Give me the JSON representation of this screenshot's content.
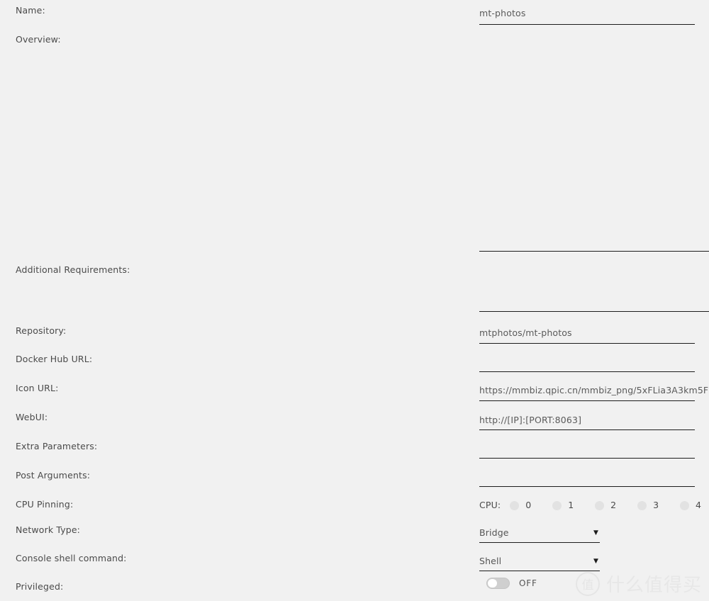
{
  "form": {
    "fields": [
      {
        "label": "Name:",
        "value": "mt-photos",
        "type": "text"
      },
      {
        "label": "Overview:",
        "value": "",
        "type": "textarea"
      },
      {
        "label": "Additional Requirements:",
        "value": "",
        "type": "textarea"
      },
      {
        "label": "Repository:",
        "value": "mtphotos/mt-photos",
        "type": "text"
      },
      {
        "label": "Docker Hub URL:",
        "value": "",
        "type": "text"
      },
      {
        "label": "Icon URL:",
        "value": "https://mmbiz.qpic.cn/mmbiz_png/5xFLia3A3km5F",
        "type": "text"
      },
      {
        "label": "WebUI:",
        "value": "http://[IP]:[PORT:8063]",
        "type": "text"
      },
      {
        "label": "Extra Parameters:",
        "value": "",
        "type": "text"
      },
      {
        "label": "Post Arguments:",
        "value": "",
        "type": "text"
      },
      {
        "label": "CPU Pinning:",
        "value": "",
        "type": "radio-group"
      },
      {
        "label": "Network Type:",
        "value": "Bridge",
        "type": "select"
      },
      {
        "label": "Console shell command:",
        "value": "Shell",
        "type": "select"
      },
      {
        "label": "Privileged:",
        "value": "OFF",
        "type": "toggle"
      }
    ],
    "cpu_pinning": {
      "caption": "CPU:",
      "options": [
        "0",
        "1",
        "2",
        "3",
        "4"
      ],
      "selected": null
    },
    "network_type": {
      "selected": "Bridge",
      "arrow": "▼"
    },
    "console_shell": {
      "selected": "Shell",
      "arrow": "▼"
    },
    "privileged": {
      "state_label": "OFF",
      "on": false
    }
  },
  "watermark": {
    "logo_char": "值",
    "text": "什么值得买"
  },
  "colors": {
    "background": "#f1f1f1",
    "underline": "#1c1c1c",
    "label": "#4a4a4a",
    "value": "#5a5a5a",
    "radio": "#e2e2e2"
  }
}
